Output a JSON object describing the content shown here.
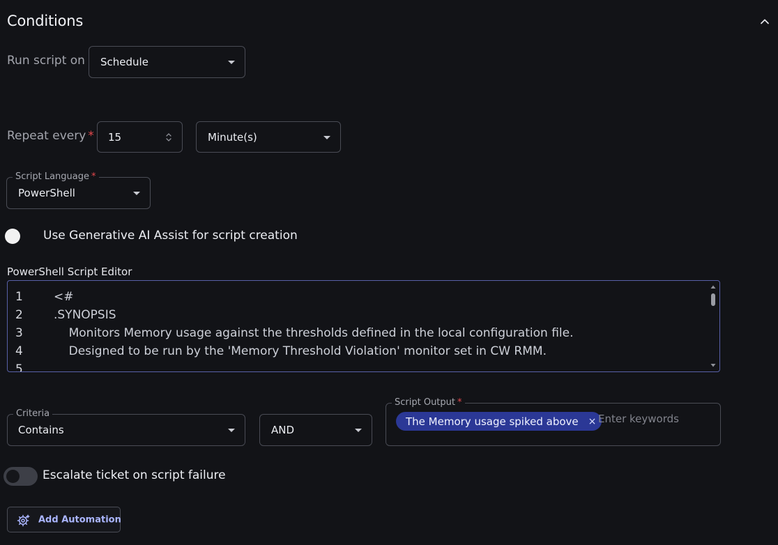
{
  "section": {
    "title": "Conditions",
    "collapse_icon": "chevron-up-icon"
  },
  "run_script_on": {
    "label": "Run script on",
    "value": "Schedule"
  },
  "repeat": {
    "label": "Repeat every",
    "required_marker": "*",
    "interval": "15",
    "unit": "Minute(s)"
  },
  "script_language": {
    "label": "Script Language",
    "required_marker": "*",
    "value": "PowerShell"
  },
  "ai_assist": {
    "label": "Use Generative AI Assist for script creation"
  },
  "editor": {
    "label": "PowerShell Script Editor",
    "lines": [
      {
        "num": "1",
        "text": "<#"
      },
      {
        "num": "2",
        "text": ".SYNOPSIS"
      },
      {
        "num": "3",
        "text": "    Monitors Memory usage against the thresholds defined in the local configuration file."
      },
      {
        "num": "4",
        "text": "    Designed to be run by the 'Memory Threshold Violation' monitor set in CW RMM."
      },
      {
        "num": "5",
        "text": ""
      }
    ]
  },
  "criteria": {
    "label": "Criteria",
    "value": "Contains",
    "operator": "AND"
  },
  "script_output": {
    "label": "Script Output",
    "required_marker": "*",
    "chip": "The Memory usage spiked above",
    "chip_remove": "×",
    "placeholder": "Enter keywords"
  },
  "escalate": {
    "label": "Escalate ticket on script failure",
    "enabled": false
  },
  "add_automation": {
    "label": "Add Automation",
    "icon": "automation-gear-icon"
  },
  "colors": {
    "background": "#121317",
    "accent": "#aab5ff",
    "chip": "#2b3896",
    "required": "#e5484d"
  }
}
